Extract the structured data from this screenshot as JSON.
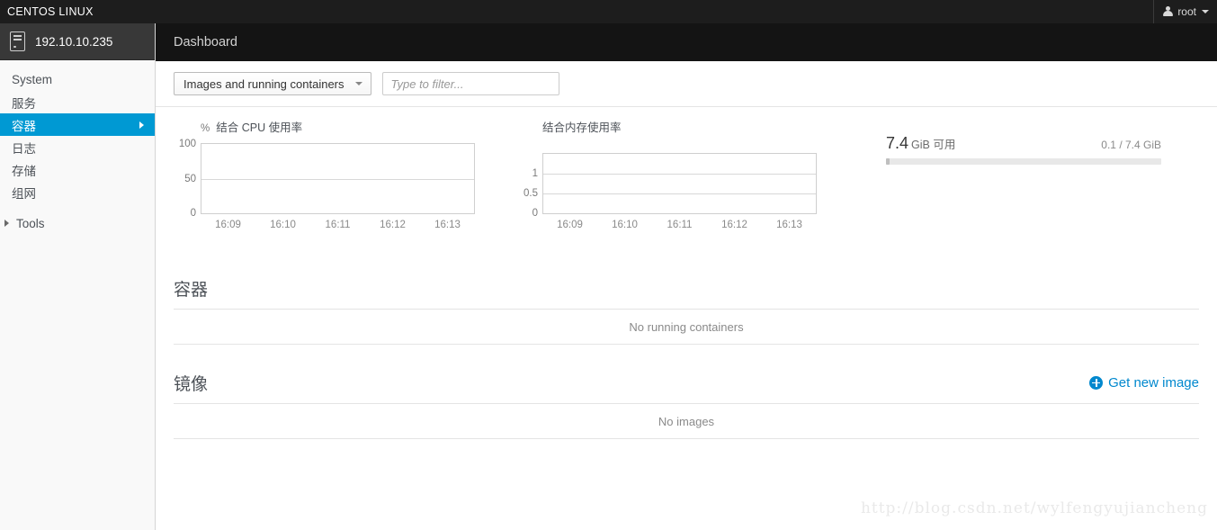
{
  "brand": {
    "title": "CENTOS LINUX",
    "user": "root",
    "user_icon": "user-icon",
    "caret_icon": "chevron-down-icon"
  },
  "sidebar": {
    "host": {
      "name": "192.10.10.235",
      "icon": "server-icon"
    },
    "items": [
      {
        "label": "System",
        "active": false
      },
      {
        "label": "服务",
        "active": false
      },
      {
        "label": "容器",
        "active": true
      },
      {
        "label": "日志",
        "active": false
      },
      {
        "label": "存储",
        "active": false
      },
      {
        "label": "组网",
        "active": false
      }
    ],
    "tools": {
      "label": "Tools",
      "icon": "chevron-right-icon"
    },
    "active_chevron": "chevron-right-icon"
  },
  "header": {
    "title": "Dashboard"
  },
  "toolbar": {
    "select_value": "Images and running containers",
    "select_caret": "chevron-down-icon",
    "filter_placeholder": "Type to filter..."
  },
  "memory_widget": {
    "available_value": "7.4",
    "available_unit": "GiB 可用",
    "ratio": "0.1 / 7.4 GiB",
    "used_percent": 1.4
  },
  "sections": {
    "containers": {
      "title": "容器",
      "empty_text": "No running containers"
    },
    "images": {
      "title": "镜像",
      "action_label": "Get new image",
      "action_icon": "plus-circle-icon",
      "empty_text": "No images"
    }
  },
  "watermark": "http://blog.csdn.net/wylfengyujiancheng",
  "colors": {
    "accent": "#0099d3",
    "link": "#0088ce",
    "brandbar": "#1d1d1d",
    "header": "#141414"
  },
  "chart_data": [
    {
      "type": "line",
      "title": "结合 CPU 使用率",
      "unit_label": "%",
      "xlabel": "",
      "ylabel": "%",
      "x": [
        "16:09",
        "16:10",
        "16:11",
        "16:12",
        "16:13"
      ],
      "yticks": [
        0,
        50,
        100
      ],
      "ylim": [
        0,
        100
      ],
      "grid": true,
      "legend": "none",
      "series": [
        {
          "name": "CPU",
          "values": [
            0,
            0,
            0,
            0,
            0
          ]
        }
      ]
    },
    {
      "type": "line",
      "title": "结合内存使用率",
      "unit_label": "",
      "xlabel": "",
      "ylabel": "",
      "x": [
        "16:09",
        "16:10",
        "16:11",
        "16:12",
        "16:13"
      ],
      "yticks": [
        0,
        0.5,
        1
      ],
      "ylim": [
        0,
        1.5
      ],
      "grid": true,
      "legend": "none",
      "series": [
        {
          "name": "Memory",
          "values": [
            0,
            0,
            0,
            0,
            0
          ]
        }
      ]
    }
  ]
}
